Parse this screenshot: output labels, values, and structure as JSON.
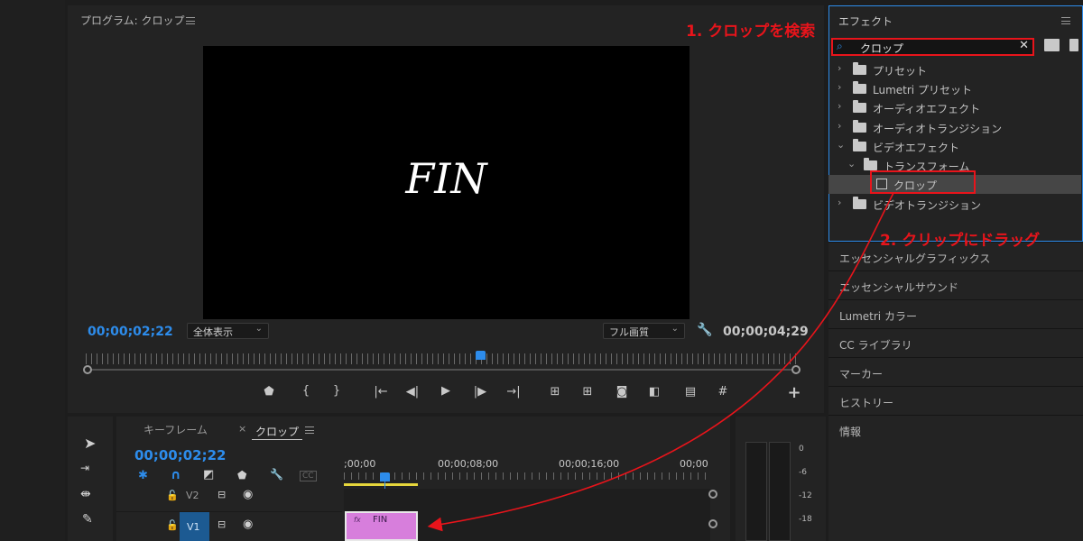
{
  "program_monitor": {
    "title": "プログラム: クロップ",
    "video_text": "FIN",
    "timecode_current": "00;00;02;22",
    "zoom_select": "全体表示",
    "quality_select": "フル画質",
    "timecode_duration": "00;00;04;29"
  },
  "effects_panel": {
    "title": "エフェクト",
    "search_value": "クロップ",
    "tree": [
      {
        "label": "プリセット",
        "expanded": false
      },
      {
        "label": "Lumetri プリセット",
        "expanded": false
      },
      {
        "label": "オーディオエフェクト",
        "expanded": false
      },
      {
        "label": "オーディオトランジション",
        "expanded": false
      },
      {
        "label": "ビデオエフェクト",
        "expanded": true
      },
      {
        "label": "トランスフォーム",
        "expanded": true
      },
      {
        "label": "クロップ",
        "selected": true
      },
      {
        "label": "ビデオトランジション",
        "expanded": false
      }
    ]
  },
  "side_panels": [
    "エッセンシャルグラフィックス",
    "エッセンシャルサウンド",
    "Lumetri カラー",
    "CC ライブラリ",
    "マーカー",
    "ヒストリー",
    "情報"
  ],
  "timeline": {
    "tab_keyframe": "キーフレーム",
    "tab_sequence": "クロップ",
    "timecode": "00;00;02;22",
    "ruler": [
      ";00;00",
      "00;00;08;00",
      "00;00;16;00",
      "00;00"
    ],
    "tracks": [
      {
        "name": "V2"
      },
      {
        "name": "V1",
        "clip": "FIN"
      }
    ]
  },
  "audio_meter": {
    "ticks": [
      "0",
      "-6",
      "-12",
      "-18"
    ]
  },
  "annotations": {
    "step1": "1. クロップを検索",
    "step2": "2. クリップにドラッグ",
    "color": "#e8141b"
  }
}
